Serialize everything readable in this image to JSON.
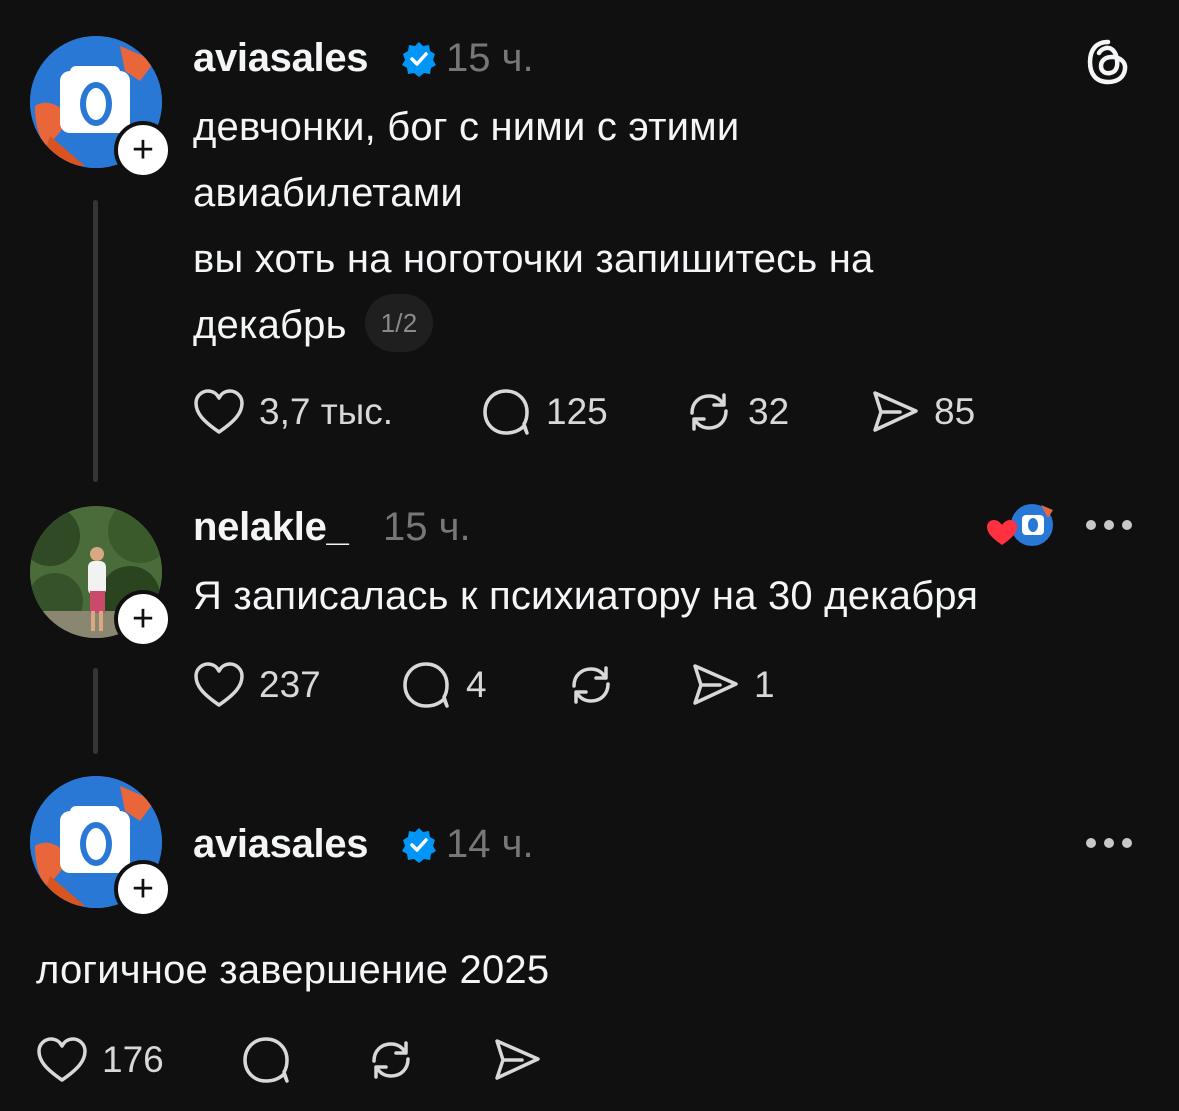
{
  "posts": [
    {
      "username": "aviasales",
      "time": "15 ч.",
      "text_lines": [
        "девчонки, бог с ними с этими",
        "авиабилетами",
        "вы хоть на ноготочки запишитесь на",
        "декабрь"
      ],
      "page_badge": "1/2",
      "likes": "3,7 тыс.",
      "replies": "125",
      "reposts": "32",
      "shares": "85"
    },
    {
      "username": "nelakle_",
      "time": "15 ч.",
      "text": "Я записалась к психиатору на 30 декабря",
      "likes": "237",
      "replies": "4",
      "reposts": "",
      "shares": "1"
    },
    {
      "username": "aviasales",
      "time": "14 ч.",
      "text": "логичное завершение 2025",
      "likes": "176",
      "replies": "",
      "reposts": "",
      "shares": ""
    }
  ],
  "icons": {
    "verified": "verified-badge-icon",
    "threads_logo": "threads-logo-icon",
    "like": "heart-icon",
    "reply": "speech-bubble-icon",
    "repost": "repost-icon",
    "share": "send-icon",
    "more": "more-dots-icon"
  },
  "colors": {
    "background": "#101010",
    "verified": "#0095f6",
    "liked_heart": "#ff3040",
    "avatar_blue": "#2a78d6",
    "leaf_orange": "#e8663a"
  }
}
